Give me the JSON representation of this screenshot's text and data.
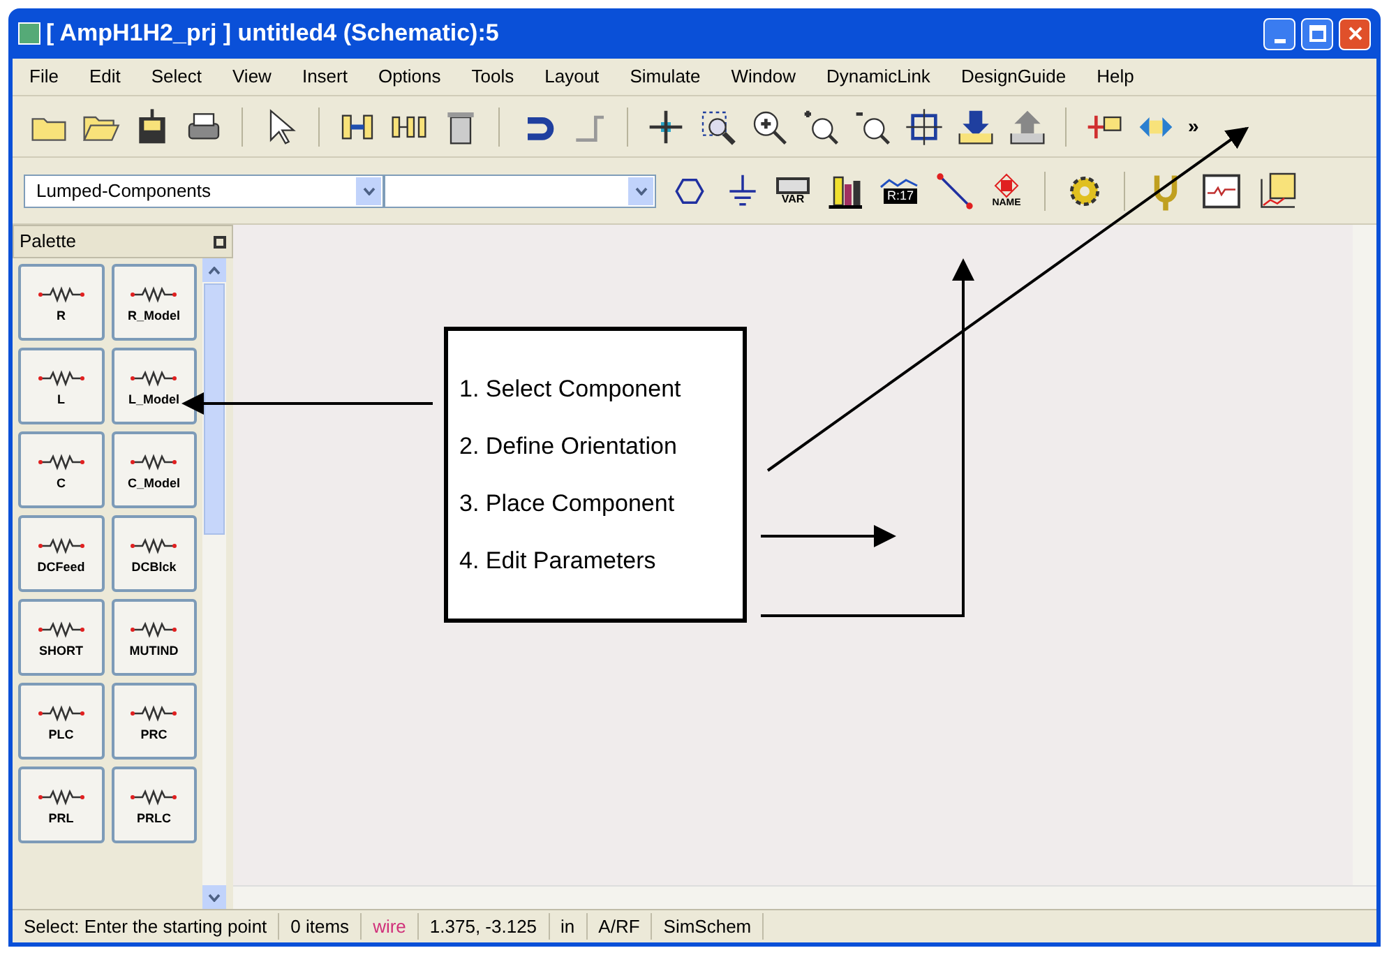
{
  "window": {
    "title": "[ AmpH1H2_prj ] untitled4 (Schematic):5"
  },
  "menu": [
    "File",
    "Edit",
    "Select",
    "View",
    "Insert",
    "Options",
    "Tools",
    "Layout",
    "Simulate",
    "Window",
    "DynamicLink",
    "DesignGuide",
    "Help"
  ],
  "toolbar": {
    "overflow": "»"
  },
  "component_bar": {
    "library": "Lumped-Components",
    "icon_captions": [
      "VAR",
      "R:17",
      "NAME"
    ]
  },
  "palette": {
    "title": "Palette",
    "items": [
      {
        "label": "R"
      },
      {
        "label": "R_Model"
      },
      {
        "label": "L"
      },
      {
        "label": "L_Model"
      },
      {
        "label": "C"
      },
      {
        "label": "C_Model"
      },
      {
        "label": "DCFeed"
      },
      {
        "label": "DCBlck"
      },
      {
        "label": "SHORT"
      },
      {
        "label": "MUTIND"
      },
      {
        "label": "PLC"
      },
      {
        "label": "PRC"
      },
      {
        "label": "PRL"
      },
      {
        "label": "PRLC"
      }
    ]
  },
  "callout": {
    "steps": [
      "1. Select Component",
      "2. Define Orientation",
      "3. Place Component",
      "4. Edit Parameters"
    ]
  },
  "status_bar": [
    {
      "text": "Select: Enter the starting point",
      "color": "#000000"
    },
    {
      "text": "0 items",
      "color": "#000000"
    },
    {
      "text": "wire",
      "color": "#d0307a"
    },
    {
      "text": "1.375, -3.125",
      "color": "#000000"
    },
    {
      "text": "in",
      "color": "#000000"
    },
    {
      "text": "A/RF",
      "color": "#000000"
    },
    {
      "text": "SimSchem",
      "color": "#000000"
    }
  ]
}
